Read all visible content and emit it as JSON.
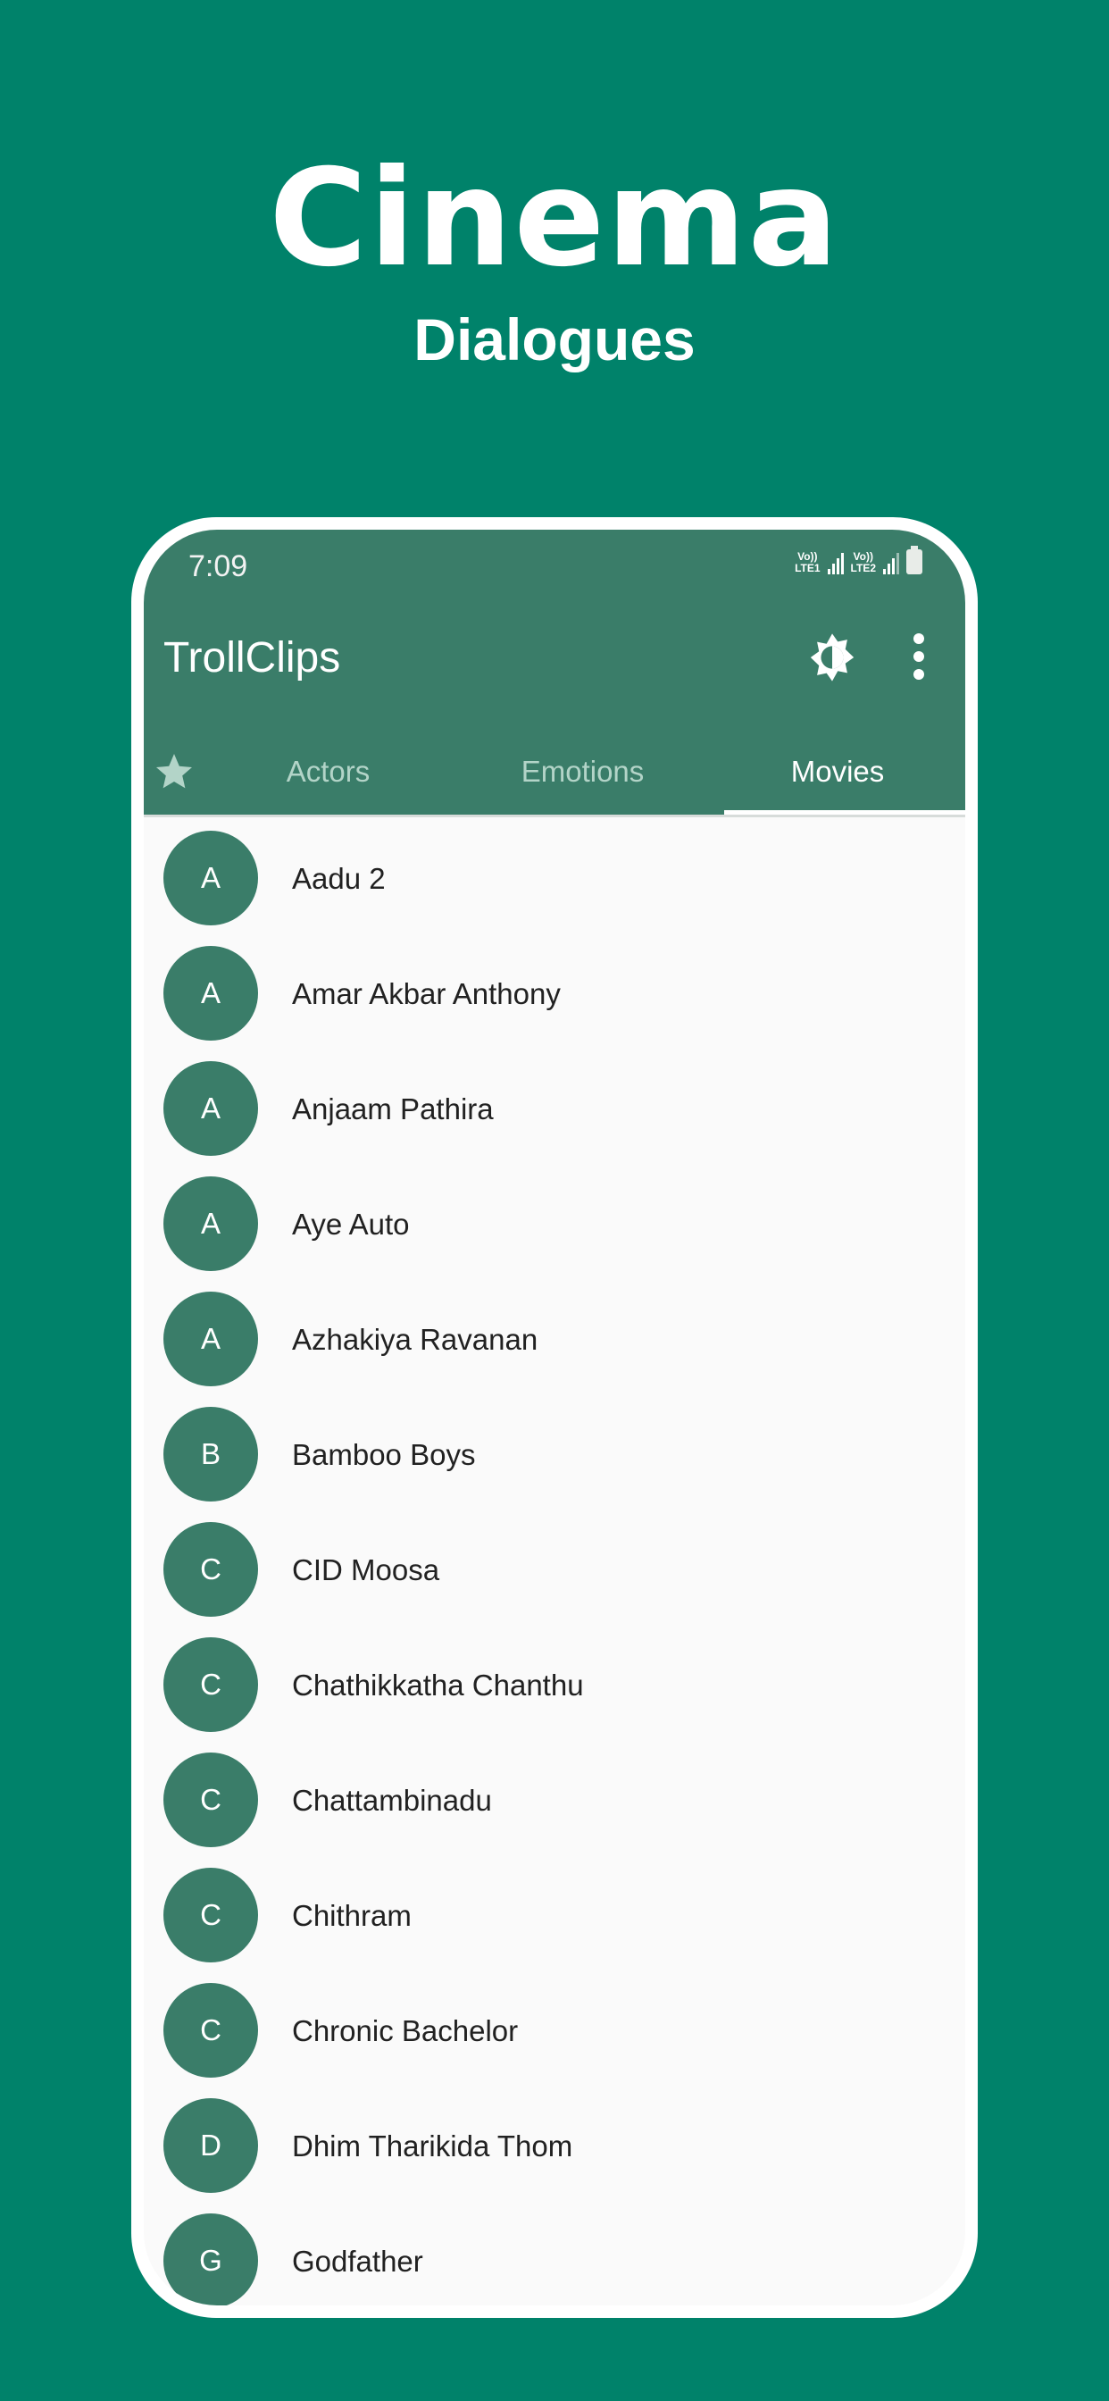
{
  "hero": {
    "title": "Cinema",
    "subtitle": "Dialogues"
  },
  "status_bar": {
    "time": "7:09",
    "sim1": "Vo)) LTE1",
    "sim2": "Vo)) LTE2",
    "icons": [
      "volte-lte1-icon",
      "signal-icon",
      "volte-lte2-icon",
      "signal-icon",
      "battery-icon"
    ]
  },
  "app_bar": {
    "title": "TrollClips",
    "actions": [
      "brightness-icon",
      "more-vert-icon"
    ]
  },
  "tabs": {
    "favorites_icon": "star-icon",
    "items": [
      {
        "label": "Actors",
        "active": false
      },
      {
        "label": "Emotions",
        "active": false
      },
      {
        "label": "Movies",
        "active": true
      }
    ]
  },
  "colors": {
    "background": "#00826a",
    "primary": "#3a7d69",
    "tab_inactive": "#b3d4c8",
    "list_bg": "#fafafa",
    "text": "#212121"
  },
  "movies": [
    {
      "initial": "A",
      "name": "Aadu 2"
    },
    {
      "initial": "A",
      "name": "Amar Akbar Anthony"
    },
    {
      "initial": "A",
      "name": "Anjaam Pathira"
    },
    {
      "initial": "A",
      "name": "Aye Auto"
    },
    {
      "initial": "A",
      "name": "Azhakiya Ravanan"
    },
    {
      "initial": "B",
      "name": "Bamboo Boys"
    },
    {
      "initial": "C",
      "name": "CID Moosa"
    },
    {
      "initial": "C",
      "name": "Chathikkatha Chanthu"
    },
    {
      "initial": "C",
      "name": "Chattambinadu"
    },
    {
      "initial": "C",
      "name": "Chithram"
    },
    {
      "initial": "C",
      "name": "Chronic Bachelor"
    },
    {
      "initial": "D",
      "name": "Dhim Tharikida Thom"
    },
    {
      "initial": "G",
      "name": "Godfather"
    }
  ]
}
